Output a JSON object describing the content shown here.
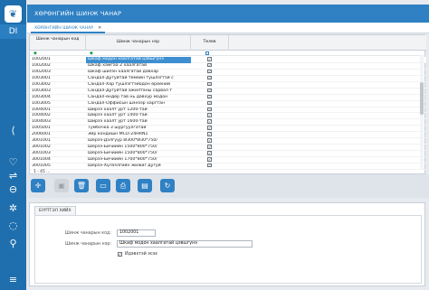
{
  "rail": {
    "logo_icon": "leaf-icon",
    "badge": "DI",
    "icons": [
      "handshake-icon",
      "heart-icon",
      "arrows-icon",
      "minus-circle-icon",
      "gear-icon",
      "balloon-icon",
      "search-icon",
      "menu-icon"
    ]
  },
  "window": {
    "title": "ХӨРӨНГИЙН ШИНЖ ЧАНАР"
  },
  "tabs": [
    {
      "label": "ХӨРӨНГИЙН ШИНЖ ЧАНАР",
      "close": "✕"
    }
  ],
  "grid": {
    "columns": [
      "Шинж чанарын код",
      "Шинж чанарын нэр",
      "Төлөв"
    ],
    "filter_marks": [
      "◆",
      "◆"
    ],
    "rows": [
      {
        "code": "1002001",
        "name": "Шкаф модон хаалгатай цэвшгүнэ",
        "status": "✓",
        "selected": true
      },
      {
        "code": "1002002",
        "name": "Шкаф хамгаа 2 хаалгатай",
        "status": "✓"
      },
      {
        "code": "1002003",
        "name": "Шкаф шилэн хаалгатай давхар",
        "status": "✓"
      },
      {
        "code": "1003001",
        "name": "Сандал-Дугуйтай төмөйн тушлэгтэй с",
        "status": "✓"
      },
      {
        "code": "1003002",
        "name": "Сандал-Хар тушлэгтэйодон өрөөний",
        "status": "✓"
      },
      {
        "code": "1003003",
        "name": "Сандал-Дугуйтай ажилтаны сарвал т",
        "status": "✓"
      },
      {
        "code": "1003004",
        "name": "Сандал-өндөр тав нь давхүр модон",
        "status": "✓"
      },
      {
        "code": "1003005",
        "name": "Сандал-Оффисын шэнээр харгтан",
        "status": "✓"
      },
      {
        "code": "1004001",
        "name": "Ширээ хаалт урт 1200-тай",
        "status": "✓"
      },
      {
        "code": "1004002",
        "name": "Ширээ хаалт урт 1400-тай",
        "status": "✓"
      },
      {
        "code": "1004003",
        "name": "Ширээ хаалт урт 1600-тай",
        "status": "✓"
      },
      {
        "code": "1005001",
        "name": "Тумбочка 3 шургуулгатай",
        "status": "✓"
      },
      {
        "code": "2006001",
        "name": "Эйр кондишн MCD-24HRN1",
        "status": "✓"
      },
      {
        "code": "3001001",
        "name": "Шерээ-Дэлгүүр  Ø300*Ø30*750/",
        "status": "✓"
      },
      {
        "code": "3001002",
        "name": "Шерээ-Бичиийн  1500*800*750/",
        "status": "✓"
      },
      {
        "code": "3001003",
        "name": "Шерээ-Бичиийн  1500*800*750/",
        "status": "✓"
      },
      {
        "code": "3001004",
        "name": "Шерээ-Бичиийн  1700*800*750/",
        "status": "✓"
      },
      {
        "code": "3001005",
        "name": "Шерээ-Хүлээлгийн жижиг дугуй",
        "status": "✓"
      }
    ],
    "pager": "1 - 45 ..."
  },
  "toolbar": {
    "buttons": [
      {
        "icon": "move-icon",
        "glyph": "✛",
        "enabled": true
      },
      {
        "icon": "save-icon",
        "glyph": "▣",
        "enabled": false
      },
      {
        "icon": "trash-icon",
        "glyph": "🗑",
        "enabled": true
      },
      {
        "icon": "folder-icon",
        "glyph": "▭",
        "enabled": true
      },
      {
        "icon": "print-icon",
        "glyph": "⎙",
        "enabled": true
      },
      {
        "icon": "export-icon",
        "glyph": "▤",
        "enabled": true
      },
      {
        "icon": "refresh-icon",
        "glyph": "↻",
        "enabled": true
      }
    ]
  },
  "form": {
    "tab": "БҮРТГЭЛ ХИЙХ",
    "code_label": "Шинж чанарын код:",
    "code_value": "1002001",
    "name_label": "Шинж чанарын нэр:",
    "name_value": "Шкаф модон хаалгатай цэвшгүнэ",
    "active_label": "Идэвхтэй эсэх",
    "active_checked": "✓"
  }
}
